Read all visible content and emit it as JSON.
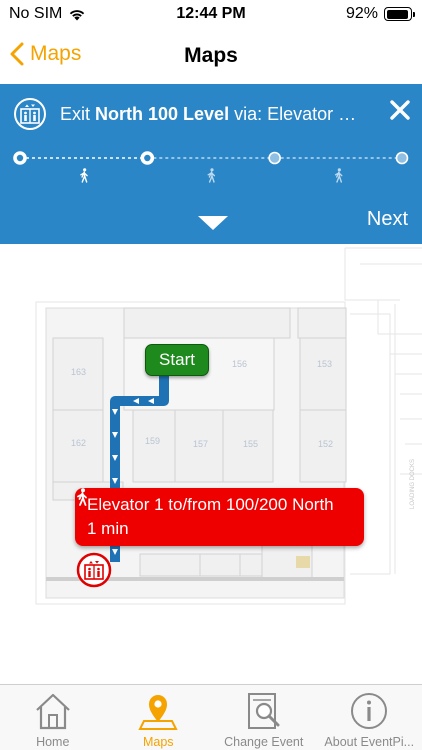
{
  "status_bar": {
    "carrier": "No SIM",
    "time": "12:44 PM",
    "battery_percent": "92%",
    "battery_level": 0.92
  },
  "nav": {
    "back_label": "Maps",
    "title": "Maps"
  },
  "directions": {
    "text_prefix": "Exit ",
    "text_bold": "North 100 Level",
    "text_suffix": " via: Elevator …",
    "next_label": "Next",
    "current_step": 2,
    "total_steps": 4,
    "colors": {
      "panel": "#2a86c6",
      "accent": "#f5a300"
    }
  },
  "map": {
    "rooms": [
      "163",
      "156",
      "153",
      "162",
      "159",
      "157",
      "155",
      "152"
    ],
    "side_label": "LOADING DOCKS",
    "start_label": "Start",
    "callout_title": "Elevator 1 to/from 100/200 North",
    "callout_time": "1 min",
    "route_color": "#1f73b5",
    "start_color": "#1e8a1e",
    "elevator_color": "#ef0000"
  },
  "tabs": [
    {
      "label": "Home",
      "icon": "house-icon",
      "active": false
    },
    {
      "label": "Maps",
      "icon": "map-pin-icon",
      "active": true
    },
    {
      "label": "Change Event",
      "icon": "search-doc-icon",
      "active": false
    },
    {
      "label": "About EventPi...",
      "icon": "info-icon",
      "active": false
    }
  ]
}
